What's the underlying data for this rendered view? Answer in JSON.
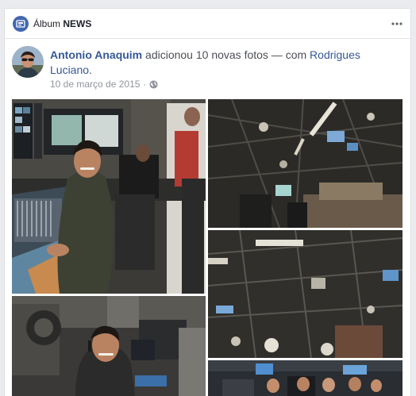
{
  "album": {
    "icon": "album-icon",
    "label_prefix": "Álbum",
    "label_name": "NEWS",
    "menu_icon": "more-horizontal-icon"
  },
  "post": {
    "author": "Antonio Anaquim",
    "action": "adicionou 10 novas fotos — com",
    "tagged_name": "Rodrigues Luciano",
    "trailing": ".",
    "date": "10 de março de 2015",
    "separator": "·",
    "privacy_icon": "globe-icon"
  },
  "photos": [
    {
      "name": "studio-control-room-photo"
    },
    {
      "name": "studio-ceiling-lights-photo-1"
    },
    {
      "name": "studio-ceiling-lights-photo-2"
    },
    {
      "name": "studio-camera-photo"
    },
    {
      "name": "studio-group-photo"
    }
  ],
  "colors": {
    "link": "#365899",
    "secondary_text": "#90949c",
    "page_background": "#e9ebee",
    "album_icon": "#4267b2"
  }
}
